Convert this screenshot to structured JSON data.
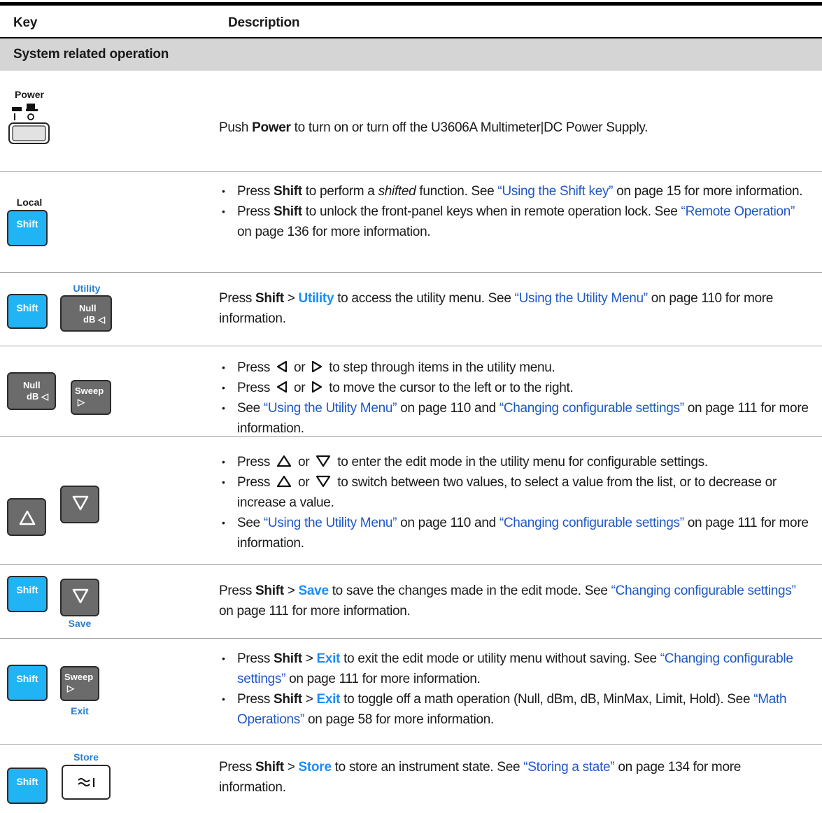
{
  "table": {
    "headers": {
      "key": "Key",
      "description": "Description"
    },
    "section": "System related operation"
  },
  "keys": {
    "power": "Power",
    "power_on": "I",
    "power_off": "O",
    "local": "Local",
    "shift": "Shift",
    "utility": "Utility",
    "null": "Null",
    "db": "dB",
    "sweep": "Sweep",
    "save": "Save",
    "exit": "Exit",
    "store": "Store"
  },
  "rows": {
    "power": {
      "t1": "Push ",
      "b1": "Power",
      "t2": " to turn on or turn off the U3606A Multimeter|DC Power Supply."
    },
    "shift": {
      "i1_t1": "Press ",
      "i1_b1": "Shift",
      "i1_t2": " to perform a ",
      "i1_em": "shifted",
      "i1_t3": " function. See ",
      "i1_link": "“Using the Shift key”",
      "i1_t4": " on page 15 for more information.",
      "i2_t1": "Press ",
      "i2_b1": "Shift",
      "i2_t2": " to unlock the front-panel keys when in remote operation lock. See ",
      "i2_link": "“Remote Operation”",
      "i2_t3": " on page 136 for more information."
    },
    "utility": {
      "t1": "Press ",
      "b1": "Shift",
      "t2": " > ",
      "b2": "Utility",
      "t3": " to access the utility menu. See ",
      "link": "“Using the Utility Menu”",
      "t4": " on page 110 for more information."
    },
    "arrows_lr": {
      "i1_t1": "Press ",
      "i1_t2": " or ",
      "i1_t3": " to step through items in the utility menu.",
      "i2_t1": "Press ",
      "i2_t2": " or ",
      "i2_t3": " to move the cursor to the left or to the right.",
      "i3_t1": "See ",
      "i3_link1": "“Using the Utility Menu”",
      "i3_t2": " on page 110 and ",
      "i3_link2": "“Changing configurable settings”",
      "i3_t3": " on page 111 for more information."
    },
    "arrows_ud": {
      "i1_t1": "Press ",
      "i1_t2": " or ",
      "i1_t3": " to enter the edit mode in the utility menu for configurable settings.",
      "i2_t1": "Press ",
      "i2_t2": " or ",
      "i2_t3": " to switch between two values, to select a value from the list, or to decrease or increase a value.",
      "i3_t1": "See ",
      "i3_link1": "“Using the Utility Menu”",
      "i3_t2": " on page 110 and ",
      "i3_link2": "“Changing configurable settings”",
      "i3_t3": " on page 111 for more information."
    },
    "save": {
      "t1": "Press ",
      "b1": "Shift",
      "t2": " > ",
      "b2": "Save",
      "t3": " to save the changes made in the edit mode. See ",
      "link": "“Changing configurable settings”",
      "t4": " on page 111 for more information."
    },
    "exit": {
      "i1_t1": "Press ",
      "i1_b1": "Shift",
      "i1_t2": " > ",
      "i1_b2": "Exit",
      "i1_t3": " to exit the edit mode or utility menu without saving. See ",
      "i1_link": "“Changing configurable settings”",
      "i1_t4": " on page 111 for more information.",
      "i2_t1": "Press ",
      "i2_b1": "Shift",
      "i2_t2": " > ",
      "i2_b2": "Exit",
      "i2_t3": " to toggle off a math operation (Null, dBm, dB, MinMax, Limit, Hold). See ",
      "i2_link": "“Math Operations”",
      "i2_t4": " on page 58 for more information."
    },
    "store": {
      "t1": "Press ",
      "b1": "Shift",
      "t2": " > ",
      "b2": "Store",
      "t3": " to store an instrument state. See ",
      "link": "“Storing a state”",
      "t4": " on page 134 for more information."
    }
  },
  "colors": {
    "shift_key": "#21b4f4",
    "gray_key": "#6b6b6b",
    "link": "#1f57c7",
    "key_label_blue": "#2a7fd0",
    "section_bg": "#d5d5d5"
  }
}
